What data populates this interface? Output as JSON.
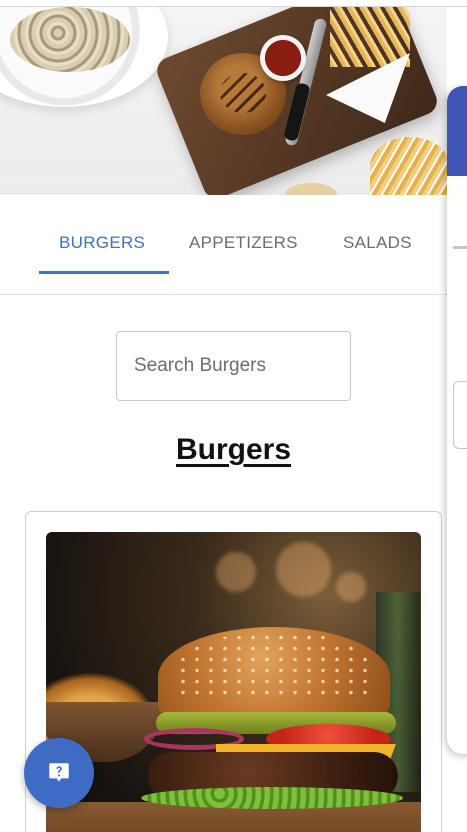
{
  "tabs": [
    {
      "label": "BURGERS",
      "active": true
    },
    {
      "label": "APPETIZERS",
      "active": false
    },
    {
      "label": "SALADS",
      "active": false
    }
  ],
  "search": {
    "placeholder": "Search Burgers",
    "value": ""
  },
  "section": {
    "title": "Burgers"
  },
  "hero": {
    "icon": "food-banner-image"
  },
  "card": {
    "image": "burger-photo"
  },
  "help_button": {
    "icon": "help-chat-icon"
  },
  "colors": {
    "accent": "#4370c2",
    "fab": "#3e6cc5",
    "drawer_header": "#3f55b5"
  }
}
